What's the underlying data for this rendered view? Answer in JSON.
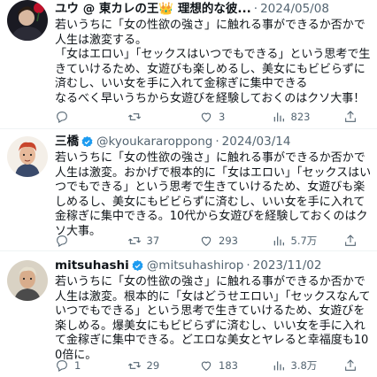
{
  "tweets": [
    {
      "name": "ユウ @ 東カレの王👑 理想的な彼...",
      "verified": false,
      "handle": "",
      "date": "2024/05/08",
      "text": "若いうちに「女の性欲の強さ」に触れる事ができるか否かで人生は激変する。\n「女はエロい」「セックスはいつでもできる」という思考で生きていけるため、女遊びも楽しめるし、美女にもビビらずに済むし、いい女を手に入れて金稼ぎに集中できる\nなるべく早いうちから女遊びを経験しておくのはクソ大事！",
      "stats": {
        "replies": "",
        "retweets": "",
        "likes": "3",
        "views": "823"
      }
    },
    {
      "name": "三橋",
      "verified": true,
      "handle": "@kyoukararoppong",
      "date": "2024/03/14",
      "text": "若いうちに「女の性欲の強さ」に触れる事ができるか否かで人生は激変。おかげで根本的に「女はエロい」「セックスはいつでもできる」という思考で生きていけるため、女遊びも楽しめるし、美女にもビビらずに済むし、いい女を手に入れて金稼ぎに集中できる。10代から女遊びを経験しておくのはクソ大事。",
      "stats": {
        "replies": "",
        "retweets": "37",
        "likes": "293",
        "views": "5.7万"
      }
    },
    {
      "name": "mitsuhashi",
      "verified": true,
      "handle": "@mitsuhashirop",
      "date": "2023/11/02",
      "text": "若いうちに「女の性欲の強さ」に触れる事ができるか否かで人生は激変。根本的に「女はどうせエロい」「セックスなんていつでもできる」という思考で生きていけるため、女遊びを楽しめる。爆美女にもビビらずに済むし、いい女を手に入れて金稼ぎに集中できる。どエロな美女とヤレると幸福度も100倍に。",
      "stats": {
        "replies": "1",
        "retweets": "29",
        "likes": "183",
        "views": "3.8万"
      }
    }
  ],
  "colors": {
    "text": "#0f1419",
    "muted": "#536471",
    "verified": "#1d9bf0",
    "divider": "#eff3f4"
  },
  "icons": [
    "reply-icon",
    "retweet-icon",
    "like-icon",
    "views-icon",
    "share-icon",
    "verified-badge-icon"
  ]
}
